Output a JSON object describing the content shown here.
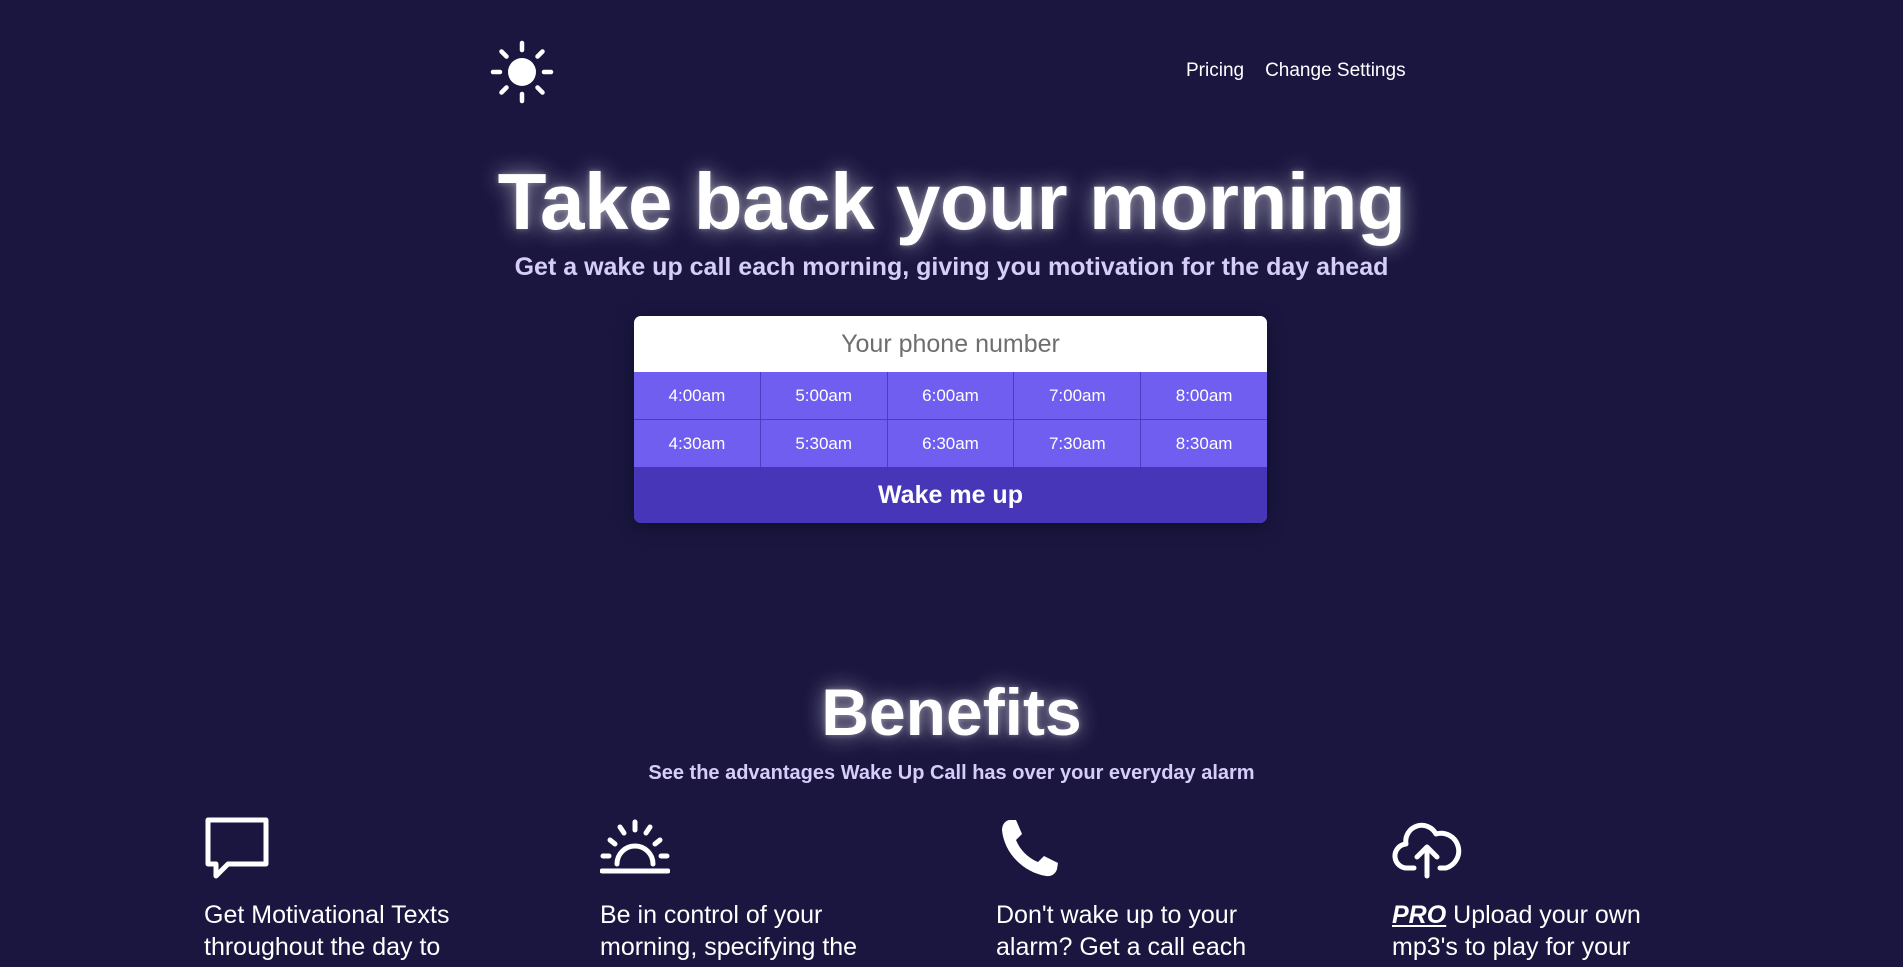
{
  "header": {
    "logo_icon": "sun-icon",
    "nav": {
      "pricing_label": "Pricing",
      "settings_label": "Change Settings"
    }
  },
  "hero": {
    "title": "Take back your morning",
    "subtitle": "Get a wake up call each morning, giving you motivation for the day ahead"
  },
  "form": {
    "phone_placeholder": "Your phone number",
    "phone_value": "",
    "times_row1": [
      "4:00am",
      "5:00am",
      "6:00am",
      "7:00am",
      "8:00am"
    ],
    "times_row2": [
      "4:30am",
      "5:30am",
      "6:30am",
      "7:30am",
      "8:30am"
    ],
    "submit_label": "Wake me up"
  },
  "benefits": {
    "title": "Benefits",
    "subtitle": "See the advantages Wake Up Call has over your everyday alarm",
    "items": [
      {
        "icon": "chat-bubble-icon",
        "text": "Get Motivational Texts throughout the day to"
      },
      {
        "icon": "sunrise-icon",
        "text": "Be in control of your morning, specifying the"
      },
      {
        "icon": "phone-icon",
        "text": "Don't wake up to your alarm? Get a call each"
      },
      {
        "icon": "cloud-upload-icon",
        "pro": "PRO",
        "text": " Upload your own mp3's to play for your"
      }
    ]
  },
  "colors": {
    "background": "#1a1640",
    "accent": "#6f5ef0",
    "accent_dark": "#4737b8",
    "subtitle": "#d6cdfa"
  }
}
